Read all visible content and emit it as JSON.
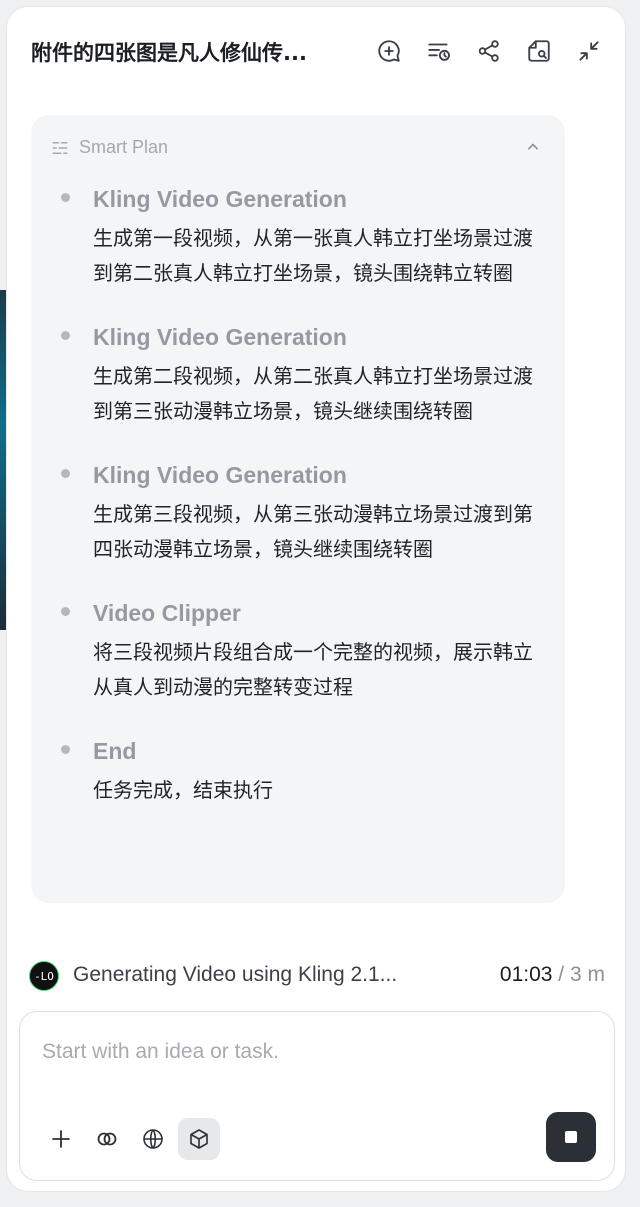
{
  "header": {
    "title": "附件的四张图是凡人修仙传...",
    "icons": [
      "new-chat-icon",
      "history-icon",
      "share-icon",
      "files-icon",
      "collapse-icon"
    ]
  },
  "plan": {
    "label": "Smart Plan",
    "steps": [
      {
        "title": "Kling Video Generation",
        "desc": "生成第一段视频，从第一张真人韩立打坐场景过渡到第二张真人韩立打坐场景，镜头围绕韩立转圈"
      },
      {
        "title": "Kling Video Generation",
        "desc": "生成第二段视频，从第二张真人韩立打坐场景过渡到第三张动漫韩立场景，镜头继续围绕转圈"
      },
      {
        "title": "Kling Video Generation",
        "desc": "生成第三段视频，从第三张动漫韩立场景过渡到第四张动漫韩立场景，镜头继续围绕转圈"
      },
      {
        "title": "Video Clipper",
        "desc": "将三段视频片段组合成一个完整的视频，展示韩立从真人到动漫的完整转变过程"
      },
      {
        "title": "End",
        "desc": "任务完成，结束执行"
      }
    ]
  },
  "status": {
    "logo_text": "-LO",
    "text": "Generating Video using Kling 2.1...",
    "elapsed": "01:03",
    "separator": "/",
    "total": "3 m"
  },
  "composer": {
    "placeholder": "Start with an idea or task.",
    "value": ""
  }
}
